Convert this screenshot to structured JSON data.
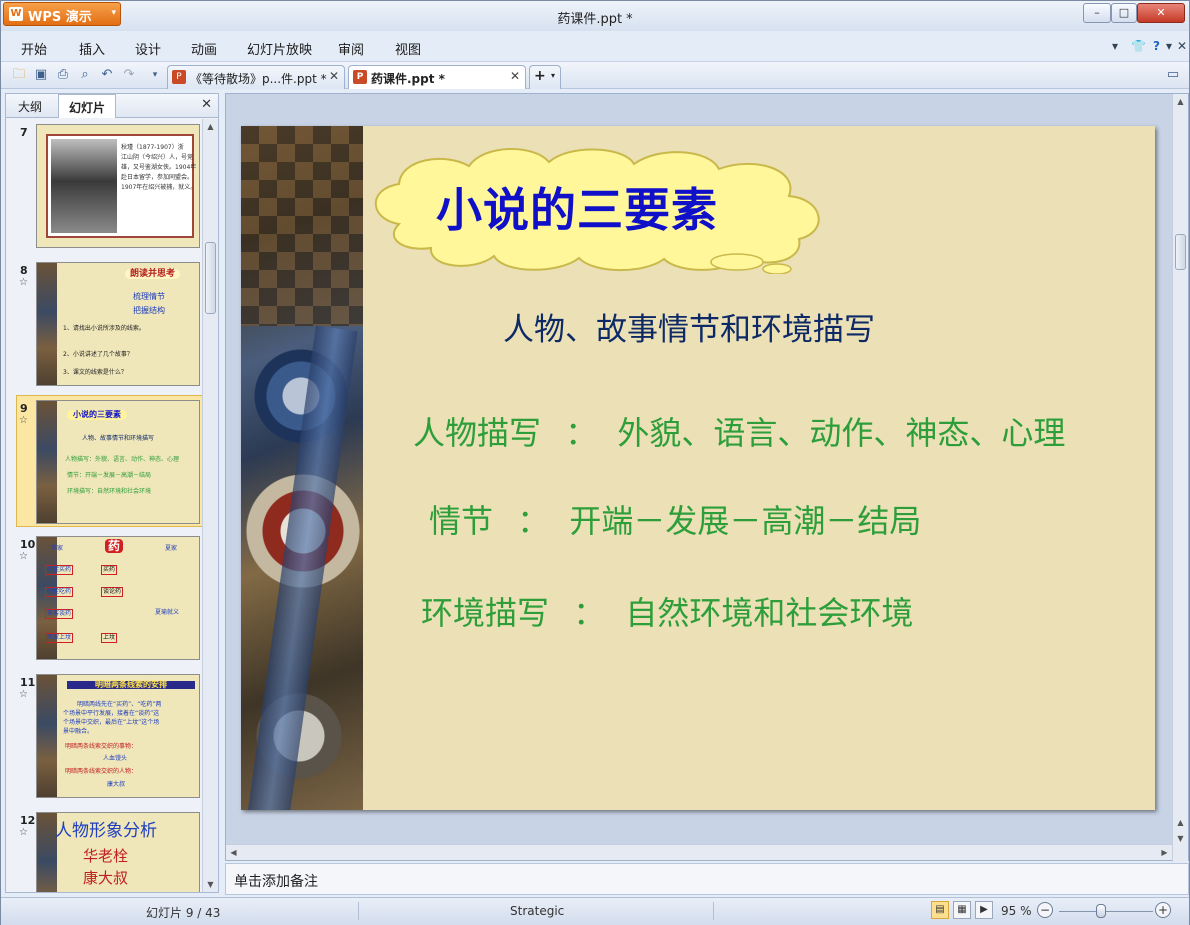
{
  "app": {
    "name": "WPS 演示",
    "logo": "W",
    "window_title": "药课件.ppt *"
  },
  "menu": [
    "开始",
    "插入",
    "设计",
    "动画",
    "幻灯片放映",
    "审阅",
    "视图"
  ],
  "tabs": [
    {
      "label": "《等待散场》p...件.ppt *",
      "icon": "P"
    },
    {
      "label": "药课件.ppt *",
      "icon": "P"
    }
  ],
  "left_pane": {
    "tabs": [
      "大纲",
      "幻灯片"
    ],
    "slides": [
      {
        "num": "7",
        "texts": [
          "秋瑾（1877-1907）浙",
          "江山阴（今绍兴）人，号竞",
          "雄，又号鉴湖女侠。1904年",
          "赴日本留学，参加同盟会。",
          "1907年在绍兴被捕，就义。"
        ]
      },
      {
        "num": "8",
        "title": "朗读并思考",
        "texts": [
          "梳理情节",
          "把握结构",
          "1、请找出小说所涉及的线索。",
          "2、小说讲述了几个故事？",
          "3、课文的线索是什么？"
        ]
      },
      {
        "num": "9",
        "title": "小说的三要素",
        "texts": [
          "人物、故事情节和环境描写",
          "人物描写：外貌、语言、动作、神态、心理",
          "情节：开端－发展－高潮－结局",
          "环境描写：自然环境和社会环境"
        ]
      },
      {
        "num": "10",
        "title": "药",
        "texts": [
          "华家",
          "夏家",
          "老栓买药",
          "买药",
          "小栓吃药",
          "谈论药",
          "茶客谈药",
          "夏瑜就义",
          "两家上坟",
          "上坟"
        ]
      },
      {
        "num": "11",
        "title": "明暗两条线索的安排",
        "texts": [
          "明暗两线先在“买药”、“吃药”两",
          "个场景中平行发展，接着在“谈药”这",
          "个场景中交织，最后在“上坟”这个场",
          "景中融合。",
          "明暗两条线索交织的事物：",
          "人血馒头",
          "明暗两条线索交织的人物：",
          "康大叔"
        ]
      },
      {
        "num": "12",
        "title": "人物形象分析",
        "texts": [
          "华老栓",
          "康大叔"
        ]
      }
    ]
  },
  "slide": {
    "title": "小说的三要素",
    "subtitle": "人物、故事情节和环境描写",
    "rows": [
      {
        "label": "人物描写",
        "sep": "：",
        "value": "外貌、语言、动作、神态、心理"
      },
      {
        "label": "情节",
        "sep": "：",
        "value": "开端－发展－高潮－结局"
      },
      {
        "label": "环境描写",
        "sep": "：",
        "value": "自然环境和社会环境"
      }
    ]
  },
  "notes_placeholder": "单击添加备注",
  "status": {
    "slide_info": "幻灯片 9 / 43",
    "theme": "Strategic",
    "zoom": "95 %"
  }
}
